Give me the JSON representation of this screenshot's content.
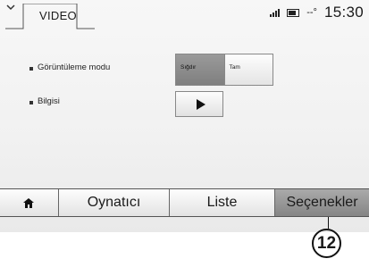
{
  "header": {
    "tab_label": "VIDEO",
    "status": {
      "signal_icon": "signal-bars-icon",
      "battery_icon": "battery-icon",
      "temperature": "--°",
      "time": "15:30"
    }
  },
  "settings": {
    "rows": [
      {
        "label": "Görüntüleme modu"
      },
      {
        "label": "Bilgisi"
      }
    ],
    "display_mode": {
      "options": [
        "Sığdır",
        "Tam"
      ],
      "selected": "Sığdır"
    },
    "info_button_icon": "play-icon"
  },
  "tabbar": {
    "home_icon": "home-icon",
    "items": [
      "Oynatıcı",
      "Liste",
      "Seçenekler"
    ],
    "active": "Seçenekler"
  },
  "callout": {
    "number": "12"
  },
  "colors": {
    "active_tab": "#8f8f8f",
    "background": "#f4f4f4"
  }
}
